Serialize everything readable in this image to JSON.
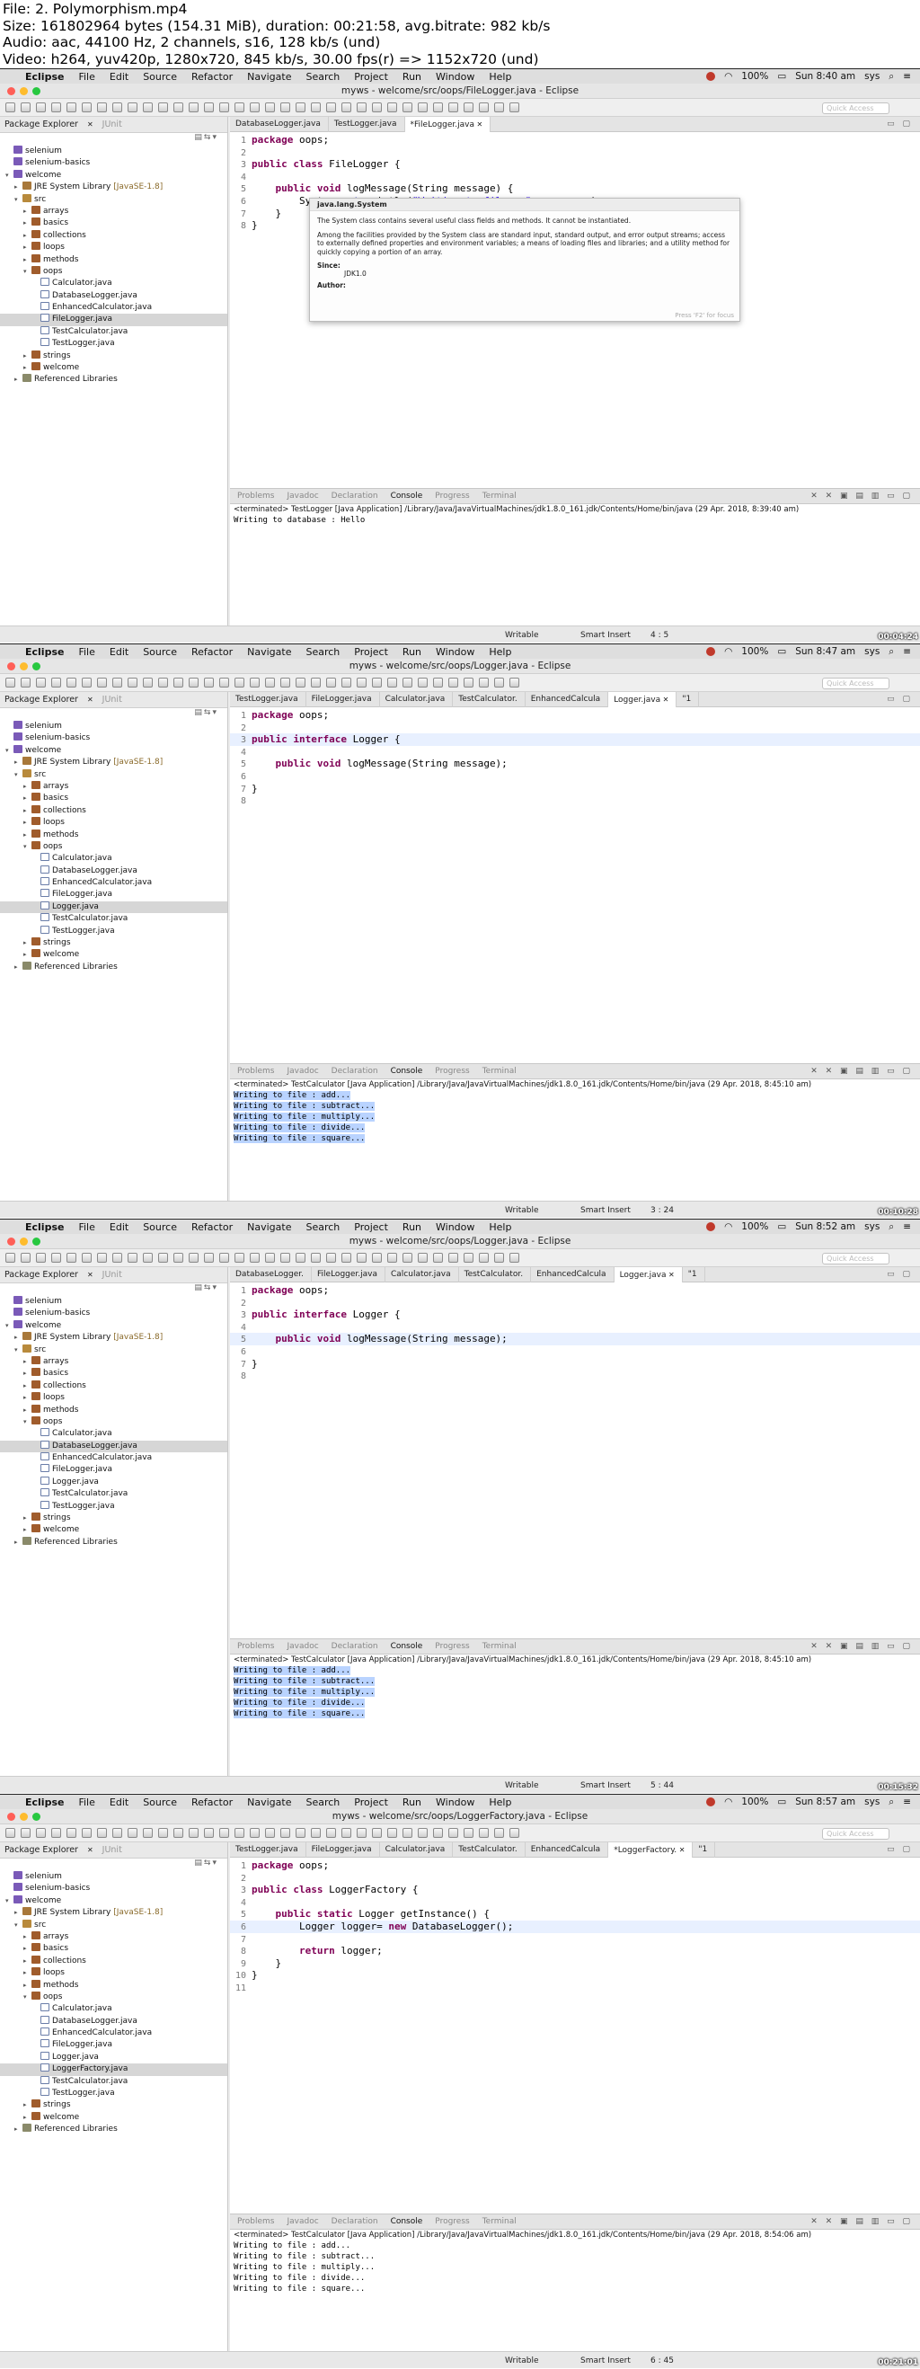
{
  "header": [
    "File: 2. Polymorphism.mp4",
    "Size: 161802964 bytes (154.31 MiB), duration: 00:21:58, avg.bitrate: 982 kb/s",
    "Audio: aac, 44100 Hz, 2 channels, s16, 128 kb/s (und)",
    "Video: h264, yuv420p, 1280x720, 845 kb/s, 30.00 fps(r) => 1152x720 (und)"
  ],
  "menu": [
    "File",
    "Edit",
    "Source",
    "Refactor",
    "Navigate",
    "Search",
    "Project",
    "Run",
    "Window",
    "Help"
  ],
  "app_name": "Eclipse",
  "battery": "100%",
  "user": "sys",
  "quick_access": "Quick Access",
  "package_explorer_label": "Package Explorer",
  "junit_label": "JUnit",
  "console_tabs": [
    "Problems",
    "Javadoc",
    "Declaration",
    "Console",
    "Progress",
    "Terminal"
  ],
  "console_active": "Console",
  "status_mode": [
    "Writable",
    "Smart Insert"
  ],
  "colors": {
    "accent": "#2a00ff",
    "keyword": "#7f0055",
    "selection": "#b9d3ff"
  },
  "javadoc": {
    "title": "java.lang.System",
    "p1": "The System class contains several useful class fields and methods. It cannot be instantiated.",
    "p2": "Among the facilities provided by the System class are standard input, standard output, and error output streams; access to externally defined properties and environment variables; a means of loading files and libraries; and a utility method for quickly copying a portion of an array.",
    "since_label": "Since:",
    "since_value": "JDK1.0",
    "author_label": "Author:",
    "footer": "Press 'F2' for focus"
  },
  "frames": [
    {
      "time": "Sun 8:40 am",
      "title": "myws - welcome/src/oops/FileLogger.java - Eclipse",
      "timecode": "00:04:24",
      "tabs": [
        {
          "label": "DatabaseLogger.java",
          "active": false
        },
        {
          "label": "TestLogger.java",
          "active": false
        },
        {
          "label": "*FileLogger.java",
          "active": true
        }
      ],
      "tree": [
        "selenium",
        "selenium-basics",
        "welcome",
        "JRE System Library",
        "src",
        "arrays",
        "basics",
        "collections",
        "loops",
        "methods",
        "oops",
        "Calculator.java",
        "DatabaseLogger.java",
        "EnhancedCalculator.java",
        "FileLogger.java",
        "TestCalculator.java",
        "TestLogger.java",
        "strings",
        "welcome",
        "Referenced Libraries"
      ],
      "tree_selected": 14,
      "code": [
        "package oops;",
        "",
        "public class FileLogger {",
        "",
        "    public void logMessage(String message) {",
        "        System.out.println(\"Writing to file : \" + message);",
        "    }",
        "}"
      ],
      "console_header": "<terminated> TestLogger [Java Application] /Library/Java/JavaVirtualMachines/jdk1.8.0_161.jdk/Contents/Home/bin/java (29 Apr. 2018, 8:39:40 am)",
      "console_lines": [
        "Writing to database : Hello"
      ],
      "console_selected": false,
      "position": "4 : 5"
    },
    {
      "time": "Sun 8:47 am",
      "title": "myws - welcome/src/oops/Logger.java - Eclipse",
      "timecode": "00:10:28",
      "tabs": [
        {
          "label": "TestLogger.java",
          "active": false
        },
        {
          "label": "FileLogger.java",
          "active": false
        },
        {
          "label": "Calculator.java",
          "active": false
        },
        {
          "label": "TestCalculator.",
          "active": false
        },
        {
          "label": "EnhancedCalcula",
          "active": false
        },
        {
          "label": "Logger.java",
          "active": true
        },
        {
          "label": "\"1",
          "active": false
        }
      ],
      "tree": [
        "selenium",
        "selenium-basics",
        "welcome",
        "JRE System Library",
        "src",
        "arrays",
        "basics",
        "collections",
        "loops",
        "methods",
        "oops",
        "Calculator.java",
        "DatabaseLogger.java",
        "EnhancedCalculator.java",
        "FileLogger.java",
        "Logger.java",
        "TestCalculator.java",
        "TestLogger.java",
        "strings",
        "welcome",
        "Referenced Libraries"
      ],
      "tree_selected": 15,
      "code": [
        "package oops;",
        "",
        "public interface Logger {",
        "",
        "    public void logMessage(String message);",
        "",
        "}",
        ""
      ],
      "console_header": "<terminated> TestCalculator [Java Application] /Library/Java/JavaVirtualMachines/jdk1.8.0_161.jdk/Contents/Home/bin/java (29 Apr. 2018, 8:45:10 am)",
      "console_lines": [
        "Writing to file : add...",
        "Writing to file : subtract...",
        "Writing to file : multiply...",
        "Writing to file : divide...",
        "Writing to file : square..."
      ],
      "console_selected": true,
      "position": "3 : 24"
    },
    {
      "time": "Sun 8:52 am",
      "title": "myws - welcome/src/oops/Logger.java - Eclipse",
      "timecode": "00:15:32",
      "tabs": [
        {
          "label": "DatabaseLogger.",
          "active": false
        },
        {
          "label": "FileLogger.java",
          "active": false
        },
        {
          "label": "Calculator.java",
          "active": false
        },
        {
          "label": "TestCalculator.",
          "active": false
        },
        {
          "label": "EnhancedCalcula",
          "active": false
        },
        {
          "label": "Logger.java",
          "active": true
        },
        {
          "label": "\"1",
          "active": false
        }
      ],
      "tree": [
        "selenium",
        "selenium-basics",
        "welcome",
        "JRE System Library",
        "src",
        "arrays",
        "basics",
        "collections",
        "loops",
        "methods",
        "oops",
        "Calculator.java",
        "DatabaseLogger.java",
        "EnhancedCalculator.java",
        "FileLogger.java",
        "Logger.java",
        "TestCalculator.java",
        "TestLogger.java",
        "strings",
        "welcome",
        "Referenced Libraries"
      ],
      "tree_selected": 12,
      "code": [
        "package oops;",
        "",
        "public interface Logger {",
        "",
        "    public void logMessage(String message);",
        "",
        "}",
        ""
      ],
      "console_header": "<terminated> TestCalculator [Java Application] /Library/Java/JavaVirtualMachines/jdk1.8.0_161.jdk/Contents/Home/bin/java (29 Apr. 2018, 8:45:10 am)",
      "console_lines": [
        "Writing to file : add...",
        "Writing to file : subtract...",
        "Writing to file : multiply...",
        "Writing to file : divide...",
        "Writing to file : square..."
      ],
      "console_selected": true,
      "position": "5 : 44"
    },
    {
      "time": "Sun 8:57 am",
      "title": "myws - welcome/src/oops/LoggerFactory.java - Eclipse",
      "timecode": "00:21:01",
      "tabs": [
        {
          "label": "TestLogger.java",
          "active": false
        },
        {
          "label": "FileLogger.java",
          "active": false
        },
        {
          "label": "Calculator.java",
          "active": false
        },
        {
          "label": "TestCalculator.",
          "active": false
        },
        {
          "label": "EnhancedCalcula",
          "active": false
        },
        {
          "label": "*LoggerFactory.",
          "active": true
        },
        {
          "label": "\"1",
          "active": false
        }
      ],
      "tree": [
        "selenium",
        "selenium-basics",
        "welcome",
        "JRE System Library",
        "src",
        "arrays",
        "basics",
        "collections",
        "loops",
        "methods",
        "oops",
        "Calculator.java",
        "DatabaseLogger.java",
        "EnhancedCalculator.java",
        "FileLogger.java",
        "Logger.java",
        "LoggerFactory.java",
        "TestCalculator.java",
        "TestLogger.java",
        "strings",
        "welcome",
        "Referenced Libraries"
      ],
      "tree_selected": 16,
      "code": [
        "package oops;",
        "",
        "public class LoggerFactory {",
        "",
        "    public static Logger getInstance() {",
        "        Logger logger= new DatabaseLogger();",
        "",
        "        return logger;",
        "    }",
        "}",
        ""
      ],
      "console_header": "<terminated> TestCalculator [Java Application] /Library/Java/JavaVirtualMachines/jdk1.8.0_161.jdk/Contents/Home/bin/java (29 Apr. 2018, 8:54:06 am)",
      "console_lines": [
        "Writing to file : add...",
        "Writing to file : subtract...",
        "Writing to file : multiply...",
        "Writing to file : divide...",
        "Writing to file : square..."
      ],
      "console_selected": false,
      "position": "6 : 45"
    }
  ]
}
